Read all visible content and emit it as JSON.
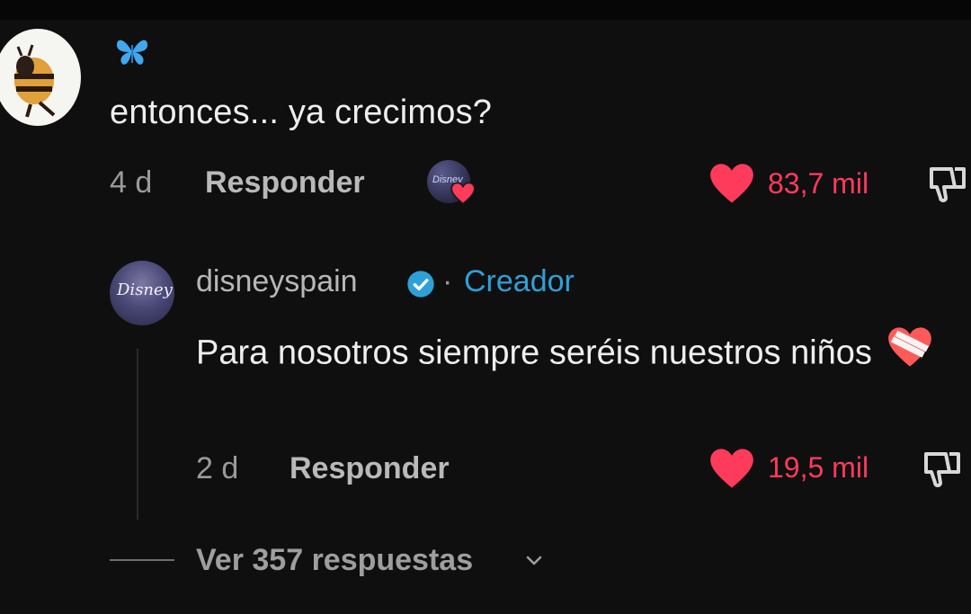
{
  "comment": {
    "text": "entonces... ya crecimos?",
    "age": "4 d",
    "reply_label": "Responder",
    "likes": "83,7 mil"
  },
  "reply": {
    "username": "disneyspain",
    "separator": "·",
    "badge": "Creador",
    "text": "Para nosotros siempre seréis nuestros niños",
    "age": "2 d",
    "reply_label": "Responder",
    "likes": "19,5 mil"
  },
  "see_replies": "Ver 357 respuestas",
  "colors": {
    "background": "#0f0f10",
    "like": "#ff3b5c",
    "creator": "#2ea0d8",
    "verified": "#2ea0d8",
    "butterfly": "#3fa8ef"
  },
  "icons": [
    "butterfly-icon",
    "heart-icon",
    "dislike-icon",
    "verified-badge-icon",
    "mending-heart-emoji",
    "chevron-down-icon"
  ]
}
